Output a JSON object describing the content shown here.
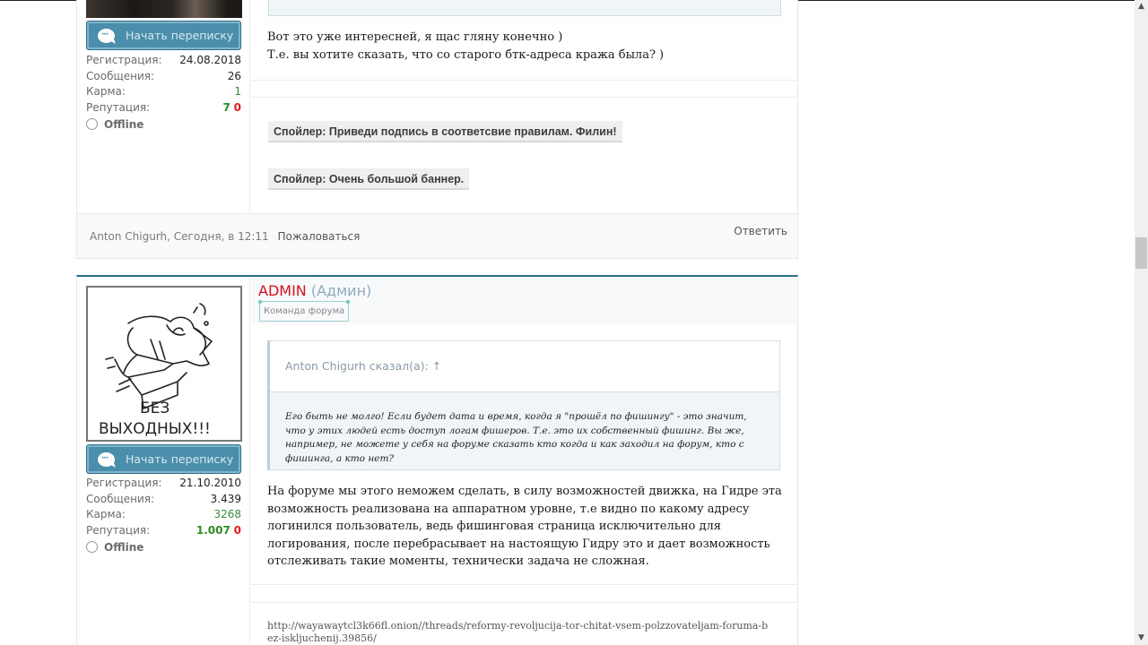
{
  "posts": [
    {
      "author_footer": "Anton Chigurh, Сегодня, в 12:11",
      "pm_button": "Начать переписку",
      "stats": {
        "reg_label": "Регистрация:",
        "reg_value": "24.08.2018",
        "msgs_label": "Сообщения:",
        "msgs_value": "26",
        "karma_label": "Карма:",
        "karma_value": "1",
        "rep_label": "Репутация:",
        "rep_pos": "7",
        "rep_neg": "0"
      },
      "status": "Offline",
      "message_lines": [
        "Вот это уже интересней, я щас гляну конечно )",
        "Т.е. вы хотите сказать, что со старого бтк-адреса кража была? )"
      ],
      "spoilers": [
        "Спойлер: Приведи подпись в соответсвие правилам. Филин!",
        "Спойлер: Очень большой баннер."
      ],
      "report_label": "Пожаловаться",
      "reply_label": "Ответить"
    },
    {
      "username": "ADMIN",
      "role": "(Админ)",
      "badge": "Команда форума",
      "avatar_caption_line1": "БЕЗ",
      "avatar_caption_line2": "ВЫХОДНЫХ!!!",
      "pm_button": "Начать переписку",
      "stats": {
        "reg_label": "Регистрация:",
        "reg_value": "21.10.2010",
        "msgs_label": "Сообщения:",
        "msgs_value": "3.439",
        "karma_label": "Карма:",
        "karma_value": "3268",
        "rep_label": "Репутация:",
        "rep_pos": "1.007",
        "rep_neg": "0"
      },
      "status": "Offline",
      "quote": {
        "header": "Anton Chigurh сказал(а): ↑",
        "text": "Его быть не молго! Если будет дата и время, когда я \"прошёл по фишингу\" - это значит, что у этих людей есть доступ логам фишеров. Т.е. это их собственный фишинг. Вы же, например, не можете у себя на форуме сказать кто когда и как заходил на форум, кто с фишинга, а кто нет?"
      },
      "message": "На форуме мы этого неможем сделать, в силу возможностей движка, на Гидре эта возможность реализована на аппаратном уровне, т.е видно по какому адресу логинился пользователь, ведь фишинговая страница исключительно для логирования, после перебрасывает на настоящую Гидру это и дает возможность отслеживать такие моменты, технически задача не сложная.",
      "signature_link": "http://wayawaytcl3k66fl.onion//threads/reformy-revoljucija-tor-chitat-vsem-polzzovateljam-foruma-bez-iskljuchenij.39856/"
    }
  ],
  "colors": {
    "accent": "#2b6c8c",
    "button": "#4a8eac",
    "admin_name": "#d4111d",
    "rep_positive": "#2f8a1f",
    "rep_negative": "#e01c1c"
  }
}
